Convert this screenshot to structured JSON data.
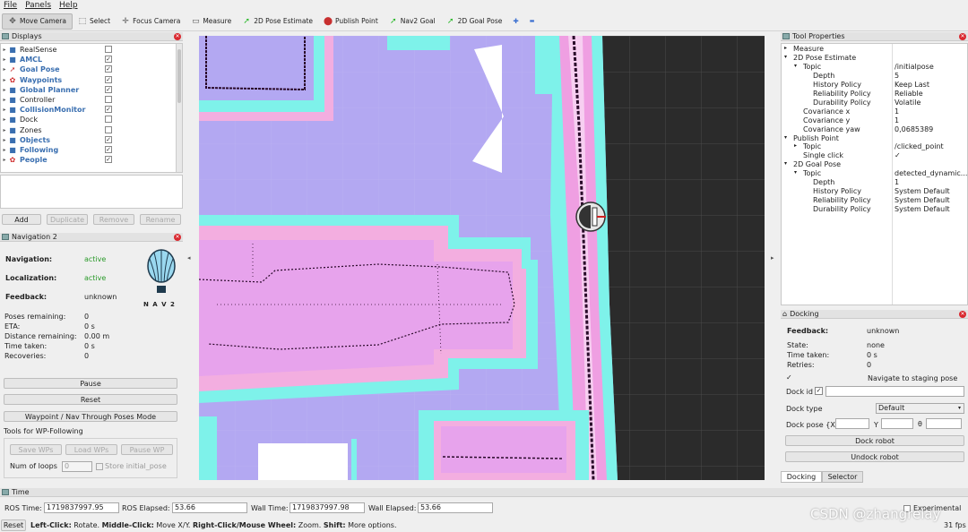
{
  "menu": [
    "File",
    "Panels",
    "Help"
  ],
  "toolbar": {
    "tools": [
      {
        "label": "Move Camera",
        "icon": "move-camera-icon",
        "glyph": "✥",
        "color": "#555"
      },
      {
        "label": "Select",
        "icon": "select-icon",
        "glyph": "⬚",
        "color": "#555"
      },
      {
        "label": "Focus Camera",
        "icon": "focus-camera-icon",
        "glyph": "✛",
        "color": "#555"
      },
      {
        "label": "Measure",
        "icon": "measure-icon",
        "glyph": "▭",
        "color": "#555"
      },
      {
        "label": "2D Pose Estimate",
        "icon": "pose-estimate-icon",
        "glyph": "➚",
        "color": "#28b828"
      },
      {
        "label": "Publish Point",
        "icon": "publish-point-icon",
        "glyph": "⬤",
        "color": "#c83030"
      },
      {
        "label": "Nav2 Goal",
        "icon": "nav2-goal-icon",
        "glyph": "➚",
        "color": "#28b828"
      },
      {
        "label": "2D Goal Pose",
        "icon": "goal-pose-icon",
        "glyph": "➚",
        "color": "#28b828"
      }
    ],
    "plus": "✚",
    "minus": "▬"
  },
  "displays": {
    "title": "Displays",
    "items": [
      {
        "label": "RealSense",
        "checked": false,
        "bold": false,
        "icon": "folder-icon",
        "glyph": "■",
        "color": "#3a6fb0"
      },
      {
        "label": "AMCL",
        "checked": true,
        "bold": true,
        "icon": "folder-icon",
        "glyph": "■",
        "color": "#3a6fb0"
      },
      {
        "label": "Goal Pose",
        "checked": true,
        "bold": true,
        "icon": "pose-icon",
        "glyph": "➚",
        "color": "#c83030"
      },
      {
        "label": "Waypoints",
        "checked": true,
        "bold": true,
        "icon": "markers-icon",
        "glyph": "✿",
        "color": "#d03030"
      },
      {
        "label": "Global Planner",
        "checked": true,
        "bold": true,
        "icon": "folder-icon",
        "glyph": "■",
        "color": "#3a6fb0"
      },
      {
        "label": "Controller",
        "checked": false,
        "bold": false,
        "icon": "folder-icon",
        "glyph": "■",
        "color": "#3a6fb0"
      },
      {
        "label": "CollisionMonitor",
        "checked": true,
        "bold": true,
        "icon": "folder-icon",
        "glyph": "■",
        "color": "#3a6fb0"
      },
      {
        "label": "Dock",
        "checked": false,
        "bold": false,
        "icon": "folder-icon",
        "glyph": "■",
        "color": "#3a6fb0"
      },
      {
        "label": "Zones",
        "checked": false,
        "bold": false,
        "icon": "folder-icon",
        "glyph": "■",
        "color": "#3a6fb0"
      },
      {
        "label": "Objects",
        "checked": true,
        "bold": true,
        "icon": "folder-icon",
        "glyph": "■",
        "color": "#3a6fb0"
      },
      {
        "label": "Following",
        "checked": true,
        "bold": true,
        "icon": "folder-icon",
        "glyph": "■",
        "color": "#3a6fb0"
      },
      {
        "label": "People",
        "checked": true,
        "bold": true,
        "icon": "markers-icon",
        "glyph": "✿",
        "color": "#d03030"
      }
    ],
    "buttons": {
      "add": "Add",
      "duplicate": "Duplicate",
      "remove": "Remove",
      "rename": "Rename"
    }
  },
  "nav2": {
    "title": "Navigation 2",
    "navigation_label": "Navigation:",
    "navigation_value": "active",
    "localization_label": "Localization:",
    "localization_value": "active",
    "feedback_label": "Feedback:",
    "feedback_value": "unknown",
    "logo_text": "N A V 2",
    "stats": [
      {
        "label": "Poses remaining:",
        "value": "0"
      },
      {
        "label": "ETA:",
        "value": "0 s"
      },
      {
        "label": "Distance remaining:",
        "value": "0.00 m"
      },
      {
        "label": "Time taken:",
        "value": "0 s"
      },
      {
        "label": "Recoveries:",
        "value": "0"
      }
    ],
    "pause": "Pause",
    "reset": "Reset",
    "waypoint_mode": "Waypoint / Nav Through Poses Mode",
    "tools_label": "Tools for WP-Following",
    "save_wps": "Save WPs",
    "load_wps": "Load WPs",
    "pause_wp": "Pause WP",
    "num_loops_label": "Num of loops",
    "num_loops_value": "0",
    "store_initial": "Store initial_pose"
  },
  "tool_properties": {
    "title": "Tool Properties",
    "rows": [
      {
        "indent": 0,
        "arrow": "▸",
        "label": "Measure",
        "value": ""
      },
      {
        "indent": 0,
        "arrow": "▾",
        "label": "2D Pose Estimate",
        "value": ""
      },
      {
        "indent": 1,
        "arrow": "▾",
        "label": "Topic",
        "value": "/initialpose"
      },
      {
        "indent": 2,
        "arrow": "",
        "label": "Depth",
        "value": "5"
      },
      {
        "indent": 2,
        "arrow": "",
        "label": "History Policy",
        "value": "Keep Last"
      },
      {
        "indent": 2,
        "arrow": "",
        "label": "Reliability Policy",
        "value": "Reliable"
      },
      {
        "indent": 2,
        "arrow": "",
        "label": "Durability Policy",
        "value": "Volatile"
      },
      {
        "indent": 1,
        "arrow": "",
        "label": "Covariance x",
        "value": "1"
      },
      {
        "indent": 1,
        "arrow": "",
        "label": "Covariance y",
        "value": "1"
      },
      {
        "indent": 1,
        "arrow": "",
        "label": "Covariance yaw",
        "value": "0,0685389"
      },
      {
        "indent": 0,
        "arrow": "▾",
        "label": "Publish Point",
        "value": ""
      },
      {
        "indent": 1,
        "arrow": "▸",
        "label": "Topic",
        "value": "/clicked_point"
      },
      {
        "indent": 1,
        "arrow": "",
        "label": "Single click",
        "value": "✓"
      },
      {
        "indent": 0,
        "arrow": "▾",
        "label": "2D Goal Pose",
        "value": ""
      },
      {
        "indent": 1,
        "arrow": "▾",
        "label": "Topic",
        "value": "detected_dynamic..."
      },
      {
        "indent": 2,
        "arrow": "",
        "label": "Depth",
        "value": "1"
      },
      {
        "indent": 2,
        "arrow": "",
        "label": "History Policy",
        "value": "System Default"
      },
      {
        "indent": 2,
        "arrow": "",
        "label": "Reliability Policy",
        "value": "System Default"
      },
      {
        "indent": 2,
        "arrow": "",
        "label": "Durability Policy",
        "value": "System Default"
      }
    ]
  },
  "docking": {
    "title": "Docking",
    "feedback_label": "Feedback:",
    "feedback_value": "unknown",
    "state_label": "State:",
    "state_value": "none",
    "time_label": "Time taken:",
    "time_value": "0 s",
    "retries_label": "Retries:",
    "retries_value": "0",
    "staging_label": "Navigate to staging pose",
    "dock_id_label": "Dock id",
    "dock_type_label": "Dock type",
    "dock_type_value": "Default",
    "dock_pose_label": "Dock pose {X",
    "y_label": "Y",
    "theta_label": "θ",
    "dock_robot": "Dock robot",
    "undock_robot": "Undock robot",
    "tabs": [
      "Docking",
      "Selector"
    ]
  },
  "time_panel": {
    "title": "Time",
    "ros_time_label": "ROS Time:",
    "ros_time": "1719837997.95",
    "ros_elapsed_label": "ROS Elapsed:",
    "ros_elapsed": "53.66",
    "wall_time_label": "Wall Time:",
    "wall_time": "1719837997.98",
    "wall_elapsed_label": "Wall Elapsed:",
    "wall_elapsed": "53.66",
    "experimental": "Experimental"
  },
  "status": {
    "reset": "Reset",
    "hint_parts": [
      "Left-Click:",
      " Rotate. ",
      "Middle-Click:",
      " Move X/Y. ",
      "Right-Click/Mouse Wheel:",
      " Zoom. ",
      "Shift:",
      " More options."
    ],
    "fps": "31 fps",
    "watermark": "CSDN @zhangrelay"
  }
}
